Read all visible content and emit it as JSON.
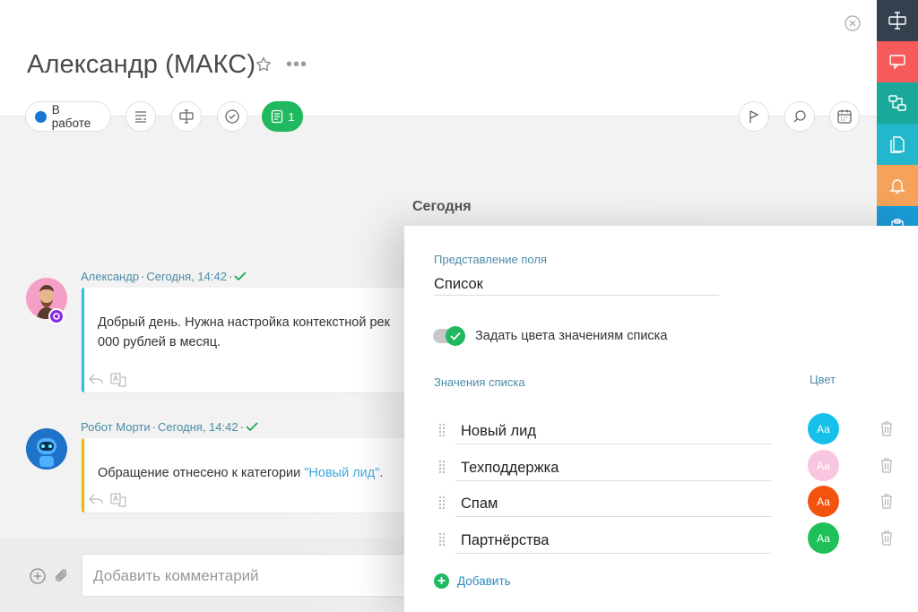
{
  "header": {
    "title": "Александр (МАКС)",
    "status_label": "В работе",
    "chat_count": "1"
  },
  "timeline": {
    "date_label": "Сегодня",
    "messages": [
      {
        "author": "Александр",
        "time": "Сегодня, 14:42",
        "text_line1": "Добрый день. Нужна настройка контекстной рек",
        "text_line2": "000 рублей в месяц.",
        "accent": "#2bbfe0"
      },
      {
        "author": "Робот Морти",
        "time": "Сегодня, 14:42",
        "text_prefix": "Обращение отнесено к категории ",
        "text_link": "\"Новый лид\"",
        "text_suffix": ".",
        "accent": "#f5b400"
      }
    ]
  },
  "comment": {
    "placeholder": "Добавить комментарий"
  },
  "panel": {
    "field_label": "Представление поля",
    "field_value": "Список",
    "toggle_label": "Задать цвета значениям списка",
    "toggle_on": true,
    "values_label": "Значения списка",
    "color_label": "Цвет",
    "items": [
      {
        "name": "Новый лид",
        "swatch_text": "Аа",
        "color": "#17c0eb"
      },
      {
        "name": "Техподдержка",
        "swatch_text": "Аа",
        "color": "#f8c6de"
      },
      {
        "name": "Спам",
        "swatch_text": "Аа",
        "color": "#f25410"
      },
      {
        "name": "Партнёрства",
        "swatch_text": "Аа",
        "color": "#1fc05a"
      }
    ],
    "add_label": "Добавить"
  },
  "rail": {
    "colors": [
      "#3a4a5a",
      "#f65a5a",
      "#1aa89b",
      "#22b7cc",
      "#f5a35a",
      "#1a9bd6"
    ]
  }
}
